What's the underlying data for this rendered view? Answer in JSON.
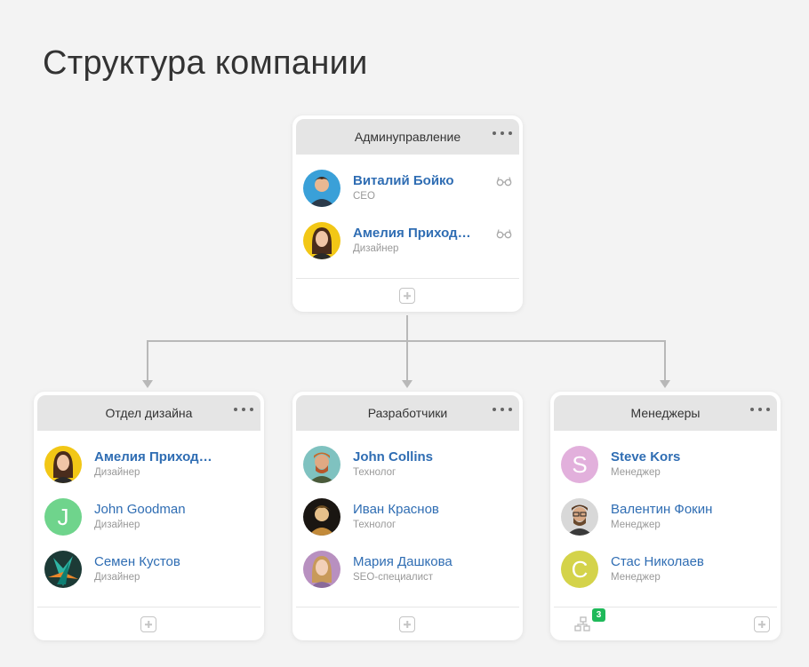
{
  "page": {
    "title": "Структура компании"
  },
  "admin": {
    "title": "Админуправление",
    "employees": [
      {
        "name": "Виталий Бойко",
        "role": "CEO"
      },
      {
        "name": "Амелия Приходько",
        "role": "Дизайнер"
      }
    ]
  },
  "design": {
    "title": "Отдел дизайна",
    "employees": [
      {
        "name": "Амелия Приходько",
        "role": "Дизайнер"
      },
      {
        "name": "John Goodman",
        "role": "Дизайнер",
        "initial": "J"
      },
      {
        "name": "Семен Кустов",
        "role": "Дизайнер"
      }
    ]
  },
  "dev": {
    "title": "Разработчики",
    "employees": [
      {
        "name": "John Collins",
        "role": "Технолог"
      },
      {
        "name": "Иван Краснов",
        "role": "Технолог"
      },
      {
        "name": "Мария Дашкова",
        "role": "SEO-специалист"
      }
    ]
  },
  "managers": {
    "title": "Менеджеры",
    "employees": [
      {
        "name": "Steve Kors",
        "role": "Менеджер",
        "initial": "S"
      },
      {
        "name": "Валентин Фокин",
        "role": "Менеджер"
      },
      {
        "name": "Стас Николаев",
        "role": "Менеджер",
        "initial": "C"
      }
    ],
    "subdepartments_count": "3"
  },
  "colors": {
    "name_link": "#2f6db3",
    "avatar_green": "#6fd48c",
    "avatar_pink": "#e2b0dc",
    "avatar_olive": "#d4d34a",
    "badge": "#1fb95a"
  },
  "icons": {
    "more": "more-dots-icon",
    "observer": "glasses-icon",
    "add": "plus-square-icon",
    "subdepartments": "hierarchy-icon"
  }
}
